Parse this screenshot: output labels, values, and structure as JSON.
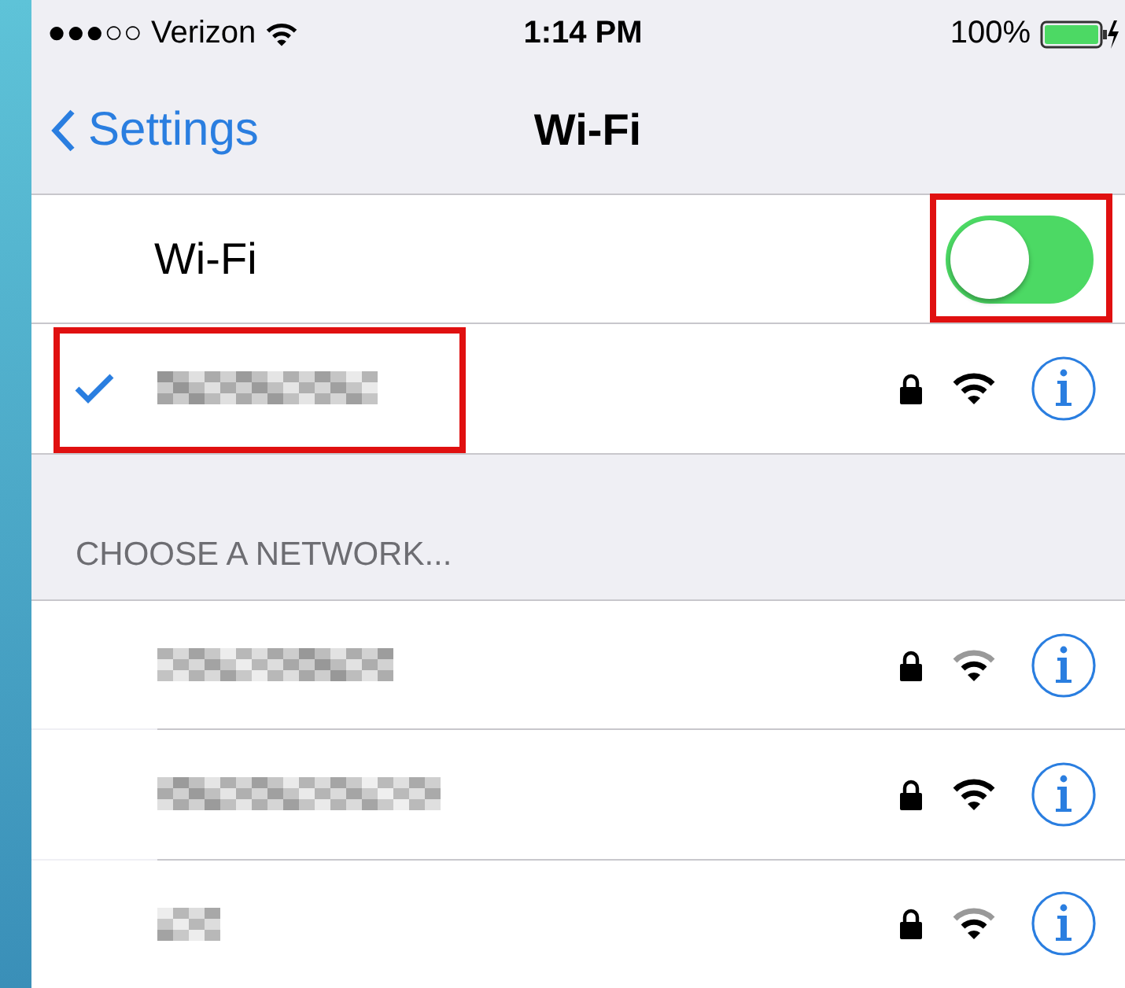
{
  "status_bar": {
    "carrier": "●●●○○ Verizon",
    "time": "1:14 PM",
    "battery": "100%",
    "charging": true
  },
  "nav_bar": {
    "back": "Settings",
    "title": "Wi-Fi"
  },
  "wifi_toggle": {
    "label": "Wi-Fi",
    "on": true,
    "highlighted": true
  },
  "connected_network": {
    "selected": true,
    "secured": true,
    "weak_signal": false,
    "highlighted": true
  },
  "section_header": "CHOOSE A NETWORK...",
  "networks": [
    {
      "secured": true,
      "weak_signal": true
    },
    {
      "secured": true,
      "weak_signal": false
    },
    {
      "secured": true,
      "weak_signal": true
    }
  ]
}
